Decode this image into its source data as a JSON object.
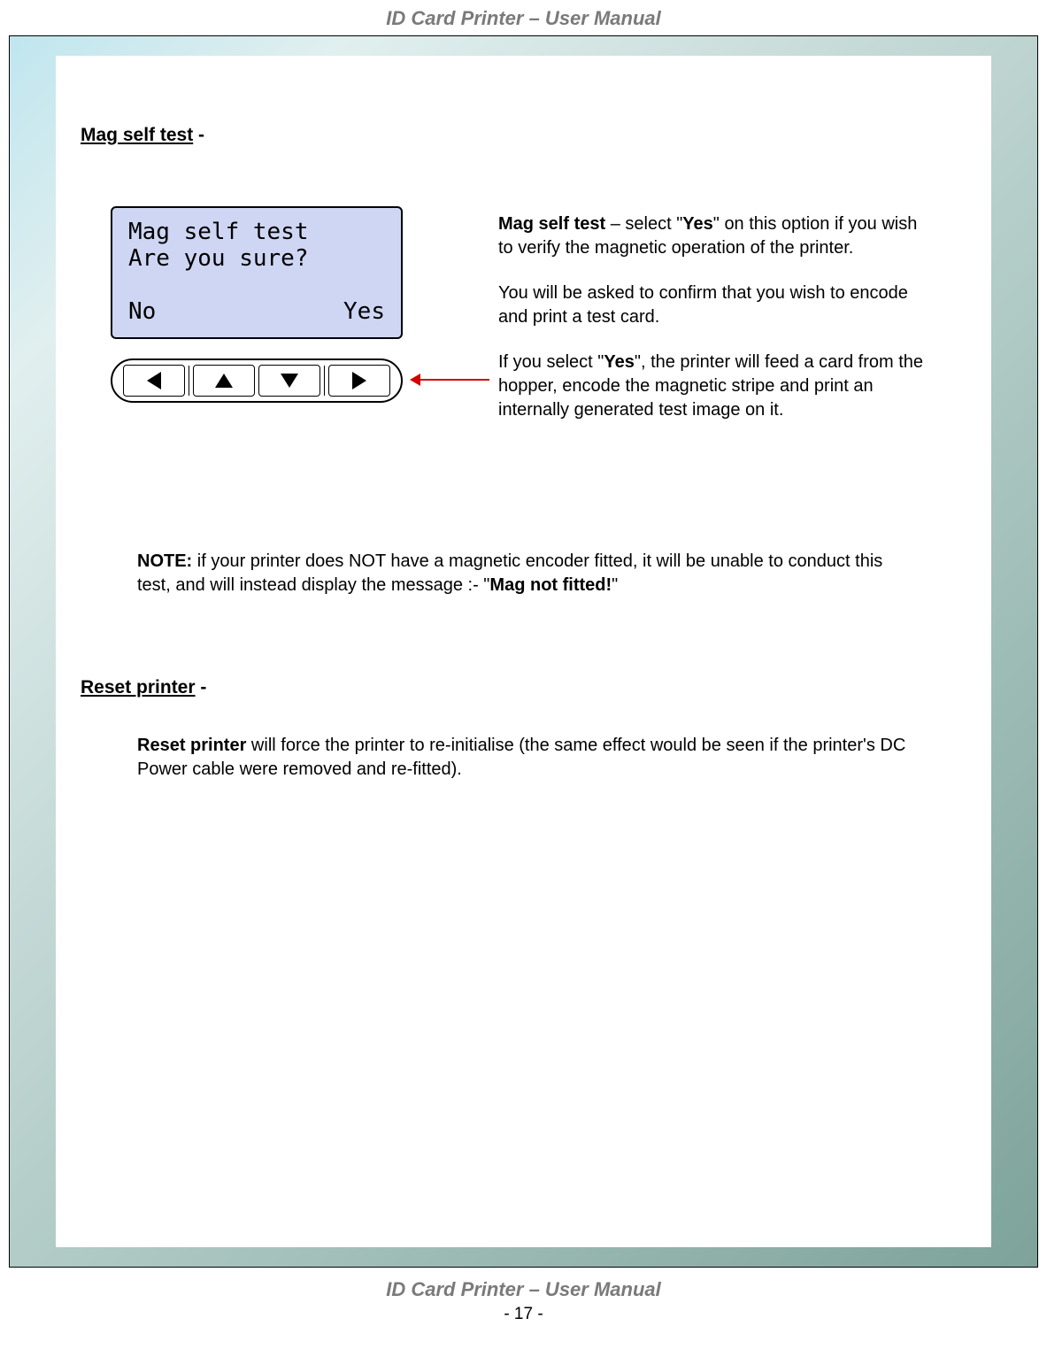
{
  "doc_title": "ID Card Printer – User Manual",
  "page_number_label": "- 17 -",
  "sections": {
    "mag": {
      "heading_underlined": "Mag self test",
      "heading_suffix": " -",
      "lcd_line1": "Mag self test",
      "lcd_line2": "Are you sure?",
      "lcd_no": "No",
      "lcd_yes": "Yes",
      "p1_prefix_bold": "Mag self test",
      "p1_mid1": " – select \"",
      "p1_yes_bold": "Yes",
      "p1_mid2": "\" on this option if you wish to verify the magnetic operation of the printer.",
      "p2": "You will be asked to confirm that you wish to encode and print a test card.",
      "p3_a": "If you select \"",
      "p3_yes_bold": "Yes",
      "p3_b": "\", the printer will feed a card from the hopper, encode the magnetic stripe and print an internally generated test image on it.",
      "note_label": "NOTE:",
      "note_body_a": "  if your printer does NOT have a magnetic encoder fitted, it will be unable to conduct this test, and will instead display the message :-  \"",
      "note_bold": "Mag not fitted!",
      "note_body_b": "\""
    },
    "reset": {
      "heading_underlined": "Reset printer",
      "heading_suffix": " -",
      "p_bold": "Reset printer",
      "p_rest": " will force the printer to re-initialise (the same effect would be seen if the printer's DC Power cable were removed and re-fitted)."
    }
  }
}
